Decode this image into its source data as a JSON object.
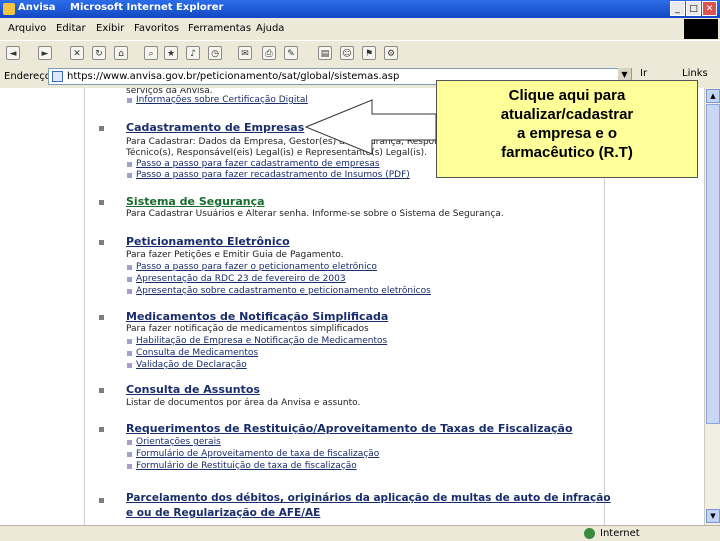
{
  "window": {
    "app_label": "Anvisa",
    "title": "Microsoft Internet Explorer",
    "controls": [
      "_",
      "□",
      "✕"
    ]
  },
  "menu": [
    "Arquivo",
    "Editar",
    "Exibir",
    "Favoritos",
    "Ferramentas",
    "Ajuda"
  ],
  "address": {
    "label": "Endereço",
    "url": "https://www.anvisa.gov.br/peticionamento/sat/global/sistemas.asp",
    "ir_label": "Ir",
    "links_label": "Links"
  },
  "content": {
    "top_cut_text": "serviços da Anvisa.",
    "top_link": "Informações sobre Certificação Digital",
    "sections": [
      {
        "title": "Cadastramento de Empresas",
        "desc": [
          "Para Cadastrar: Dados da Empresa, Gestor(es) de Segurança, Responsável(eis)",
          "Técnico(s), Responsável(eis) Legal(is) e Representante(s) Legal(is)."
        ],
        "links": [
          "Passo a passo para fazer cadastramento de empresas",
          "Passo a passo para fazer recadastramento de Insumos (PDF)"
        ]
      },
      {
        "title": "Sistema de Segurança",
        "desc": [
          "Para Cadastrar Usuários e Alterar senha. Informe-se sobre o Sistema de Segurança."
        ],
        "links": []
      },
      {
        "title": "Peticionamento Eletrônico",
        "desc": [
          "Para fazer Petições e Emitir Guia de Pagamento."
        ],
        "links": [
          "Passo a passo para fazer o peticionamento eletrônico",
          "Apresentação da RDC 23 de fevereiro de 2003",
          "Apresentação sobre cadastramento e peticionamento eletrônicos"
        ]
      },
      {
        "title": "Medicamentos de Notificação Simplificada",
        "desc": [
          "Para fazer notificação de medicamentos simplificados"
        ],
        "links": [
          "Habilitação de Empresa e Notificação de Medicamentos",
          "Consulta de Medicamentos",
          "Validação de Declaração"
        ]
      },
      {
        "title": "Consulta de Assuntos",
        "desc": [
          "Listar de documentos por área da Anvisa e assunto."
        ],
        "links": []
      },
      {
        "title": "Requerimentos de Restituição/Aproveitamento de Taxas de Fiscalização",
        "desc": [],
        "links": [
          "Orientações gerais",
          "Formulário de Aproveitamento de taxa de fiscalização",
          "Formulário de Restituição de taxa de fiscalização"
        ]
      },
      {
        "title": "Parcelamento dos débitos, originários da aplicação de multas de auto de infração",
        "title2": "e ou de Regularização de AFE/AE",
        "desc": [],
        "links": []
      }
    ]
  },
  "status": {
    "zone": "Internet"
  },
  "callout": {
    "lines": [
      "Clique aqui para",
      "atualizar/cadastrar",
      "a empresa e o",
      "farmacêutico (R.T)"
    ]
  }
}
